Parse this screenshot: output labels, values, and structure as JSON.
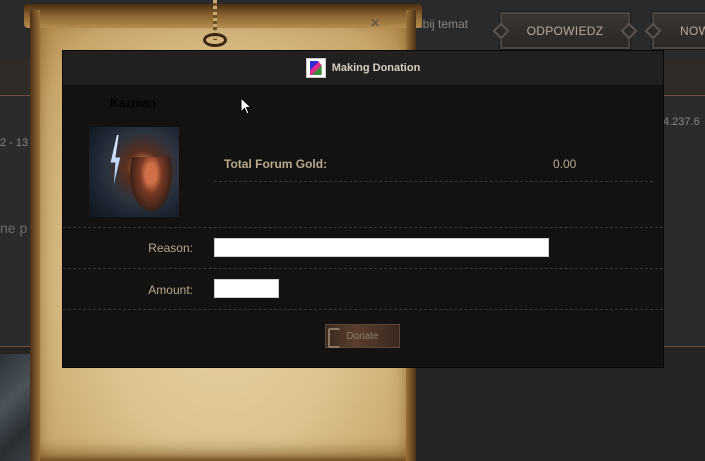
{
  "background": {
    "top_link": "dbij temat",
    "reply_button": "ODPOWIEDZ",
    "new_button": "NOW",
    "side_text_left": "2 - 13",
    "side_text_right": "4.237.6",
    "body_text_left": "ne p"
  },
  "modal": {
    "title": "Making Donation",
    "close_glyph": "×",
    "user": {
      "name": "Kazman"
    },
    "gold": {
      "label": "Total Forum Gold:",
      "value": "0.00"
    },
    "reason": {
      "label": "Reason:",
      "value": ""
    },
    "amount": {
      "label": "Amount:",
      "value": ""
    },
    "donate_label": "Donate"
  },
  "icons": {
    "header": "donation-icon",
    "close": "close-icon",
    "cursor": "mouse-cursor-icon"
  },
  "colors": {
    "modal_bg": "#141210",
    "header_bg": "#22201e",
    "label_text": "#b9a98f",
    "parchment": "#dcc390"
  }
}
